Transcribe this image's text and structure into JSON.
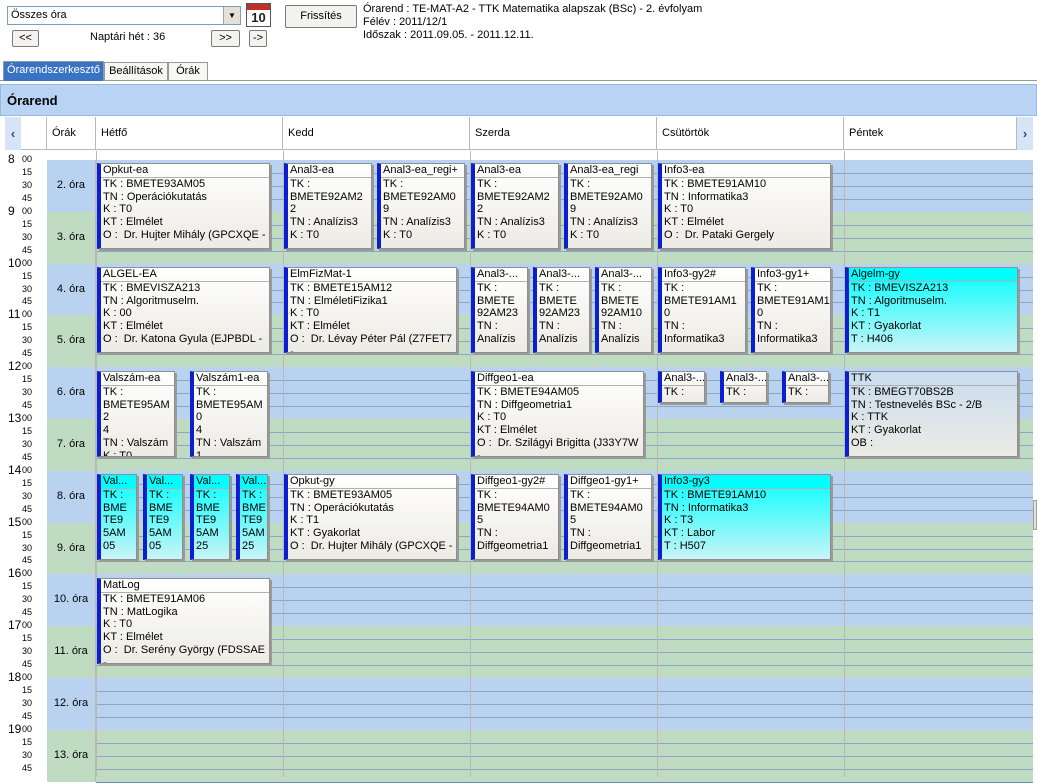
{
  "toolbar": {
    "filter_value": "Összes óra",
    "calendar_icon_day": "10",
    "refresh_label": "Frissítés",
    "prev_week_label": "<<",
    "next_week_label": ">>",
    "last_week_label": "->",
    "week_text": "Naptári hét : 36",
    "info_line1": "Órarend : TE-MAT-A2 - TTK Matematika alapszak (BSc) - 2. évfolyam",
    "info_line2": "Félév : 2011/12/1",
    "info_line3": "Időszak : 2011.09.05. - 2011.12.11."
  },
  "tabs": [
    {
      "label": "Órarendszerkesztő",
      "active": true
    },
    {
      "label": "Beállítások",
      "active": false
    },
    {
      "label": "Órák",
      "active": false
    }
  ],
  "panel_title": "Órarend",
  "nav": {
    "left": "‹",
    "right": "›"
  },
  "day_headers": {
    "periods": "Órák",
    "days": [
      "Hétfő",
      "Kedd",
      "Szerda",
      "Csütörtök",
      "Péntek"
    ]
  },
  "hours": [
    "8",
    "9",
    "10",
    "11",
    "12",
    "13",
    "14",
    "15",
    "16",
    "17",
    "18",
    "19"
  ],
  "minutes": [
    "00",
    "15",
    "30",
    "45"
  ],
  "periods": [
    "2. óra",
    "3. óra",
    "4. óra",
    "5. óra",
    "6. óra",
    "7. óra",
    "8. óra",
    "9. óra",
    "10. óra",
    "11. óra",
    "12. óra",
    "13. óra"
  ],
  "events": [
    {
      "title": "Opkut-ea",
      "lines": "TK : BMETE93AM05\nTN : Operációkutatás\nK : T0\nKT : Elmélet\nO :  Dr. Hujter Mihály (GPCXQE -",
      "style": "normal"
    },
    {
      "title": "Anal3-ea",
      "lines": "TK :\nBMETE92AM2\n2\nTN : Analízis3\nK : T0",
      "style": "normal"
    },
    {
      "title": "Anal3-ea_regi+",
      "lines": "TK :\nBMETE92AM0\n9\nTN : Analízis3\nK : T0",
      "style": "normal"
    },
    {
      "title": "Anal3-ea",
      "lines": "TK :\nBMETE92AM2\n2\nTN : Analízis3\nK : T0",
      "style": "normal"
    },
    {
      "title": "Anal3-ea_regi",
      "lines": "TK :\nBMETE92AM0\n9\nTN : Analízis3\nK : T0",
      "style": "normal"
    },
    {
      "title": "Info3-ea",
      "lines": "TK : BMETE91AM10\nTN : Informatika3\nK : T0\nKT : Elmélet\nO :  Dr. Pataki Gergely",
      "style": "normal"
    },
    {
      "title": "ALGEL-EA",
      "lines": "TK : BMEVISZA213\nTN : Algoritmuselm.\nK : 00\nKT : Elmélet\nO :  Dr. Katona Gyula (EJPBDL -",
      "style": "normal"
    },
    {
      "title": "ElmFizMat-1",
      "lines": "TK : BMETE15AM12\nTN : ElméletiFizika1\nK : T0\nKT : Elmélet\nO :  Dr. Lévay Péter Pál (Z7FET7 -",
      "style": "normal"
    },
    {
      "title": "Anal3-...",
      "lines": "TK :\nBMETE\n92AM23\nTN :\nAnalízis",
      "style": "normal"
    },
    {
      "title": "Anal3-...",
      "lines": "TK :\nBMETE\n92AM23\nTN :\nAnalízis",
      "style": "normal"
    },
    {
      "title": "Anal3-...",
      "lines": "TK :\nBMETE\n92AM10\nTN :\nAnalízis",
      "style": "normal"
    },
    {
      "title": "Info3-gy2#",
      "lines": "TK :\nBMETE91AM1\n0\nTN :\nInformatika3",
      "style": "normal"
    },
    {
      "title": "Info3-gy1+",
      "lines": "TK :\nBMETE91AM1\n0\nTN :\nInformatika3",
      "style": "normal"
    },
    {
      "title": "Algelm-gy",
      "lines": "TK : BMEVISZA213\nTN : Algoritmuselm.\nK : T1\nKT : Gyakorlat\nT : H406",
      "style": "cyan"
    },
    {
      "title": "Valszám-ea",
      "lines": "TK :\nBMETE95AM2\n4\nTN : Valszám\nK : T0",
      "style": "normal"
    },
    {
      "title": "Valszám1-ea",
      "lines": "TK :\nBMETE95AM0\n4\nTN : Valszám1\nK : T0",
      "style": "normal"
    },
    {
      "title": "Diffgeo1-ea",
      "lines": "TK : BMETE94AM05\nTN : Diffgeometria1\nK : T0\nKT : Elmélet\nO :  Dr. Szilágyi Brigitta (J33Y7W -",
      "style": "normal"
    },
    {
      "title": "Anal3-...",
      "lines": "TK :",
      "style": "normal"
    },
    {
      "title": "Anal3-...",
      "lines": "TK :",
      "style": "normal"
    },
    {
      "title": "Anal3-...",
      "lines": "TK :",
      "style": "normal"
    },
    {
      "title": "TTK",
      "lines": "TK : BMEGT70BS2B\nTN : Testnevelés BSc - 2/B\nK : TTK\nKT : Gyakorlat\nOB :",
      "style": "gray"
    },
    {
      "title": "Val...",
      "lines": "TK :\nBME\nTE9\n5AM\n05",
      "style": "cyan"
    },
    {
      "title": "Val...",
      "lines": "TK :\nBME\nTE9\n5AM\n05",
      "style": "cyan"
    },
    {
      "title": "Val...",
      "lines": "TK :\nBME\nTE9\n5AM\n25",
      "style": "cyan"
    },
    {
      "title": "Val...",
      "lines": "TK :\nBME\nTE9\n5AM\n25",
      "style": "cyan"
    },
    {
      "title": "Opkut-gy",
      "lines": "TK : BMETE93AM05\nTN : Operációkutatás\nK : T1\nKT : Gyakorlat\nO :  Dr. Hujter Mihály (GPCXQE -",
      "style": "normal"
    },
    {
      "title": "Diffgeo1-gy2#",
      "lines": "TK :\nBMETE94AM0\n5\nTN :\nDiffgeometria1",
      "style": "normal"
    },
    {
      "title": "Diffgeo1-gy1+",
      "lines": "TK :\nBMETE94AM0\n5\nTN :\nDiffgeometria1",
      "style": "normal"
    },
    {
      "title": "Info3-gy3",
      "lines": "TK : BMETE91AM10\nTN : Informatika3\nK : T3\nKT : Labor\nT : H507",
      "style": "cyan"
    },
    {
      "title": "MatLog",
      "lines": "TK : BMETE91AM06\nTN : MatLogika\nK : T0\nKT : Elmélet\nO :  Dr. Serény György (FDSSAE -",
      "style": "normal"
    }
  ]
}
